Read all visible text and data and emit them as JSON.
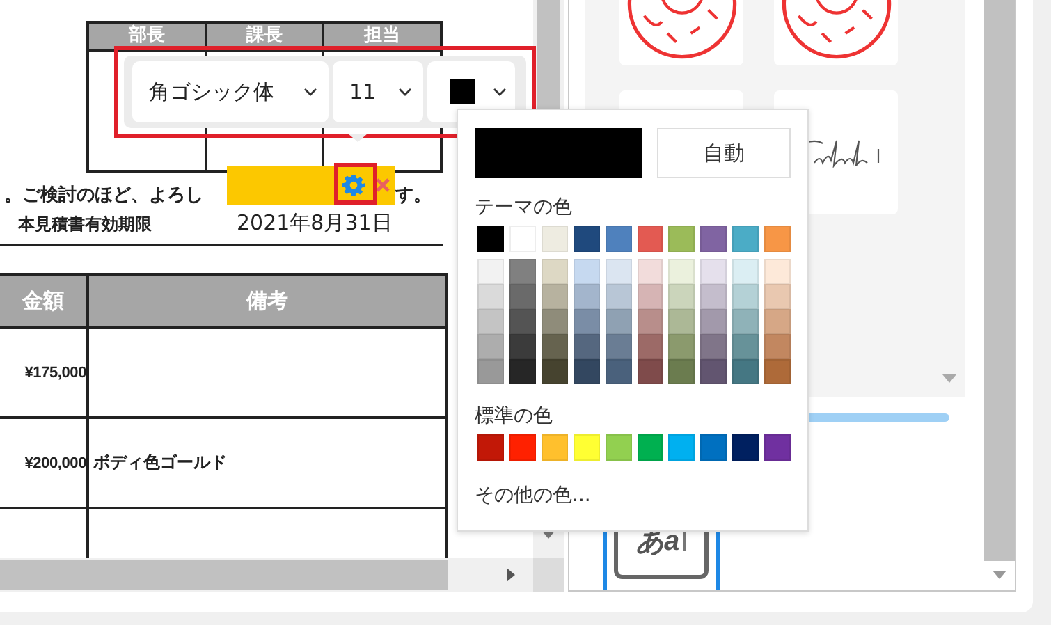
{
  "document": {
    "approval_headers": [
      "部長",
      "課長",
      "担当"
    ],
    "message_before": "。ご検討のほど、よろし",
    "message_after": "す。",
    "validity_label": "本見積書有効期限",
    "validity_date": "2021年8月31日",
    "items_table": {
      "columns": [
        "金額",
        "備考"
      ],
      "rows": [
        {
          "amount": "¥175,000"
        },
        {
          "amount": "¥200,000",
          "note": "ボディ色ゴールド"
        }
      ]
    }
  },
  "toolbar": {
    "font": "角ゴシック体",
    "size": "11",
    "color": "#000000"
  },
  "color_picker": {
    "auto_label": "自動",
    "theme_label": "テーマの色",
    "theme_colors": [
      {
        "color": "#000000"
      },
      {
        "color": "#ffffff"
      },
      {
        "color": "#eeece1"
      },
      {
        "color": "#1f497d"
      },
      {
        "color": "#4f81bd"
      },
      {
        "color": "#e35a52"
      },
      {
        "color": "#9bbb59"
      },
      {
        "color": "#8064a2"
      },
      {
        "color": "#4bacc6"
      },
      {
        "color": "#f79646"
      }
    ],
    "shades": [
      {
        "swatches": [
          {
            "color": "#f2f2f2"
          },
          {
            "color": "#808080"
          },
          {
            "color": "#ddd8c4"
          },
          {
            "color": "#c6d9f0"
          },
          {
            "color": "#dbe5f1"
          },
          {
            "color": "#f2dcdb"
          },
          {
            "color": "#ebf1dd"
          },
          {
            "color": "#e5e0ec"
          },
          {
            "color": "#dbeef3"
          },
          {
            "color": "#fde9d9"
          }
        ]
      },
      {
        "swatches": [
          {
            "color": "#dadada"
          },
          {
            "color": "#6a6a6a"
          },
          {
            "color": "#b7b29f"
          },
          {
            "color": "#a3b5cc"
          },
          {
            "color": "#b8c6d6"
          },
          {
            "color": "#d6b4b4"
          },
          {
            "color": "#cbd5bb"
          },
          {
            "color": "#c4bdcc"
          },
          {
            "color": "#b4d1d6"
          },
          {
            "color": "#e9c8b0"
          }
        ]
      },
      {
        "swatches": [
          {
            "color": "#c4c4c4"
          },
          {
            "color": "#545454"
          },
          {
            "color": "#8f8c7a"
          },
          {
            "color": "#7a8da6"
          },
          {
            "color": "#8fa1b3"
          },
          {
            "color": "#b88e8b"
          },
          {
            "color": "#acb896"
          },
          {
            "color": "#a299ab"
          },
          {
            "color": "#8fb2b8"
          },
          {
            "color": "#d6a786"
          }
        ]
      },
      {
        "swatches": [
          {
            "color": "#adadad"
          },
          {
            "color": "#3b3b3b"
          },
          {
            "color": "#66634f"
          },
          {
            "color": "#55677f"
          },
          {
            "color": "#6a7d94"
          },
          {
            "color": "#9c6a67"
          },
          {
            "color": "#8b9a6d"
          },
          {
            "color": "#807589"
          },
          {
            "color": "#679299"
          },
          {
            "color": "#c28760"
          }
        ]
      },
      {
        "swatches": [
          {
            "color": "#999999"
          },
          {
            "color": "#262626"
          },
          {
            "color": "#46432f"
          },
          {
            "color": "#334760"
          },
          {
            "color": "#4a617c"
          },
          {
            "color": "#7f4b4b"
          },
          {
            "color": "#6b7c4f"
          },
          {
            "color": "#625570"
          },
          {
            "color": "#457783"
          },
          {
            "color": "#ae6a39"
          }
        ]
      }
    ],
    "standard_label": "標準の色",
    "standard_colors": [
      {
        "color": "#c21807"
      },
      {
        "color": "#ff2100"
      },
      {
        "color": "#ffc02d"
      },
      {
        "color": "#ffff33"
      },
      {
        "color": "#92d050"
      },
      {
        "color": "#00b050"
      },
      {
        "color": "#00b0f0"
      },
      {
        "color": "#0070c0"
      },
      {
        "color": "#002060"
      },
      {
        "color": "#7030a0"
      }
    ],
    "more_label": "その他の色..."
  },
  "stamp_panel": {
    "text_stamp_label": "あa"
  }
}
